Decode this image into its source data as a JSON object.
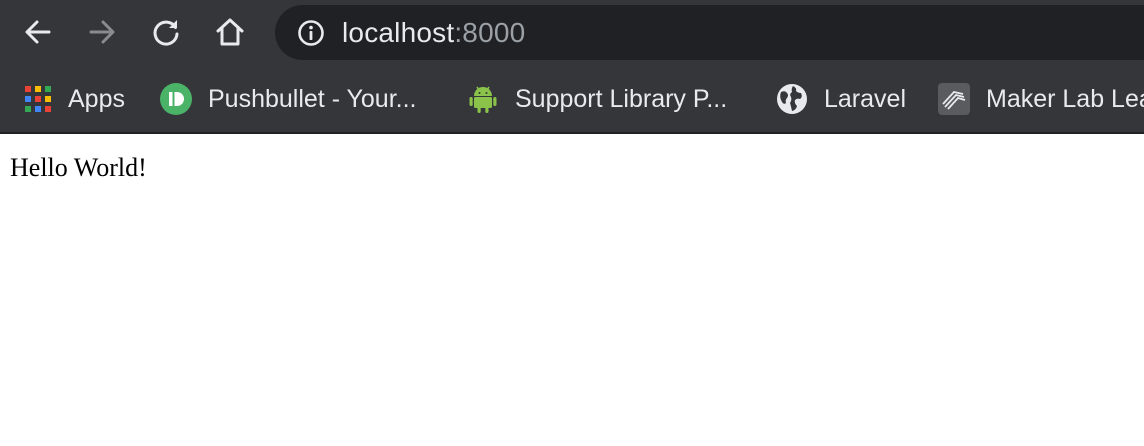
{
  "toolbar": {
    "url_host": "localhost",
    "url_port": ":8000"
  },
  "bookmarks": [
    {
      "label": "Apps",
      "icon": "apps-grid-icon"
    },
    {
      "label": "Pushbullet - Your...",
      "icon": "pushbullet-icon"
    },
    {
      "label": "Support Library P...",
      "icon": "android-icon"
    },
    {
      "label": "Laravel",
      "icon": "globe-icon"
    },
    {
      "label": "Maker Lab Lea",
      "icon": "maker-lab-icon"
    }
  ],
  "page": {
    "body_text": "Hello World!"
  },
  "colors": {
    "chrome_background": "#35363a",
    "omnibox_background": "#202124",
    "text_primary": "#e8eaed",
    "text_secondary": "#9aa0a6",
    "pushbullet_green": "#4ab367",
    "android_green": "#8bc34a"
  }
}
